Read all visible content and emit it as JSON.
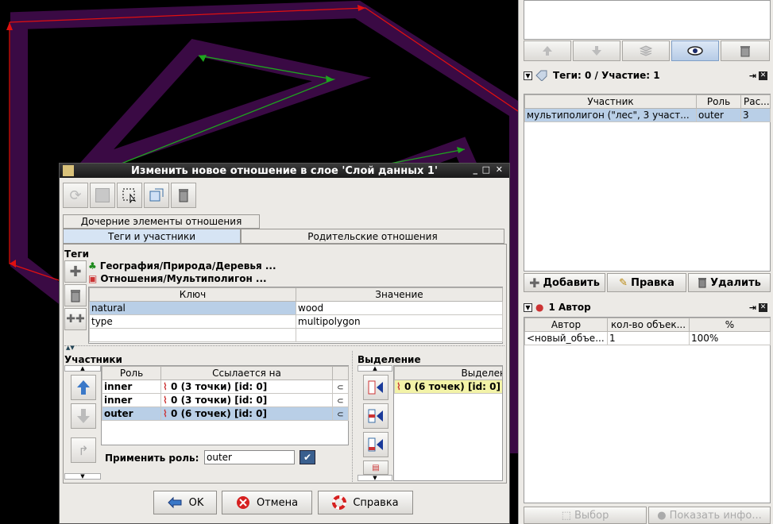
{
  "right_panel": {
    "toolbar": {
      "up_icon": "arrow-up-icon",
      "down_icon": "arrow-down-icon",
      "layers_icon": "layers-icon",
      "eye_icon": "eye-icon",
      "trash_icon": "trash-icon"
    },
    "membership": {
      "title": "Теги: 0 / Участие: 1",
      "columns": [
        "Участник",
        "Роль",
        "Рас..."
      ],
      "rows": [
        {
          "member": "мультиполигон (\"лес\", 3 участ...",
          "role": "outer",
          "pos": "3"
        }
      ],
      "add_label": "Добавить",
      "edit_label": "Правка",
      "delete_label": "Удалить"
    },
    "authors": {
      "title": "1 Автор",
      "columns": [
        "Автор",
        "кол-во объек...",
        "%"
      ],
      "rows": [
        {
          "author": "<новый_объе...",
          "count": "1",
          "percent": "100%"
        }
      ]
    },
    "bottom": {
      "select_label": "Выбор",
      "info_label": "Показать инфо..."
    }
  },
  "dialog": {
    "title": "Изменить новое отношение в слое 'Слой данных 1'",
    "tabs": {
      "children": "Дочерние элементы отношения",
      "tags_members": "Теги и участники",
      "parents": "Родительские отношения"
    },
    "tags": {
      "label": "Теги",
      "presets": [
        "География/Природа/Деревья ...",
        "Отношения/Мультиполигон ..."
      ],
      "columns": [
        "Ключ",
        "Значение"
      ],
      "rows": [
        {
          "key": "natural",
          "value": "wood"
        },
        {
          "key": "type",
          "value": "multipolygon"
        }
      ]
    },
    "members": {
      "label": "Участники",
      "columns": [
        "Роль",
        "Ссылается на"
      ],
      "rows": [
        {
          "role": "inner",
          "ref": "0 (3 точки) [id: 0]"
        },
        {
          "role": "inner",
          "ref": "0 (3 точки) [id: 0]"
        },
        {
          "role": "outer",
          "ref": "0 (6 точек) [id: 0]"
        }
      ],
      "apply_role_label": "Применить роль:",
      "apply_role_value": "outer"
    },
    "selection": {
      "label": "Выделение",
      "column": "Выделение",
      "rows": [
        "0 (6 точек) [id: 0]"
      ]
    },
    "buttons": {
      "ok": "OK",
      "cancel": "Отмена",
      "help": "Справка"
    }
  },
  "colors": {
    "selection_bg": "#b9cfe7",
    "polygon_outer": "#3a0a44",
    "relation_red": "#e01010",
    "way_green": "#1ea51e",
    "highlight_yellow": "#f3f3a8"
  }
}
